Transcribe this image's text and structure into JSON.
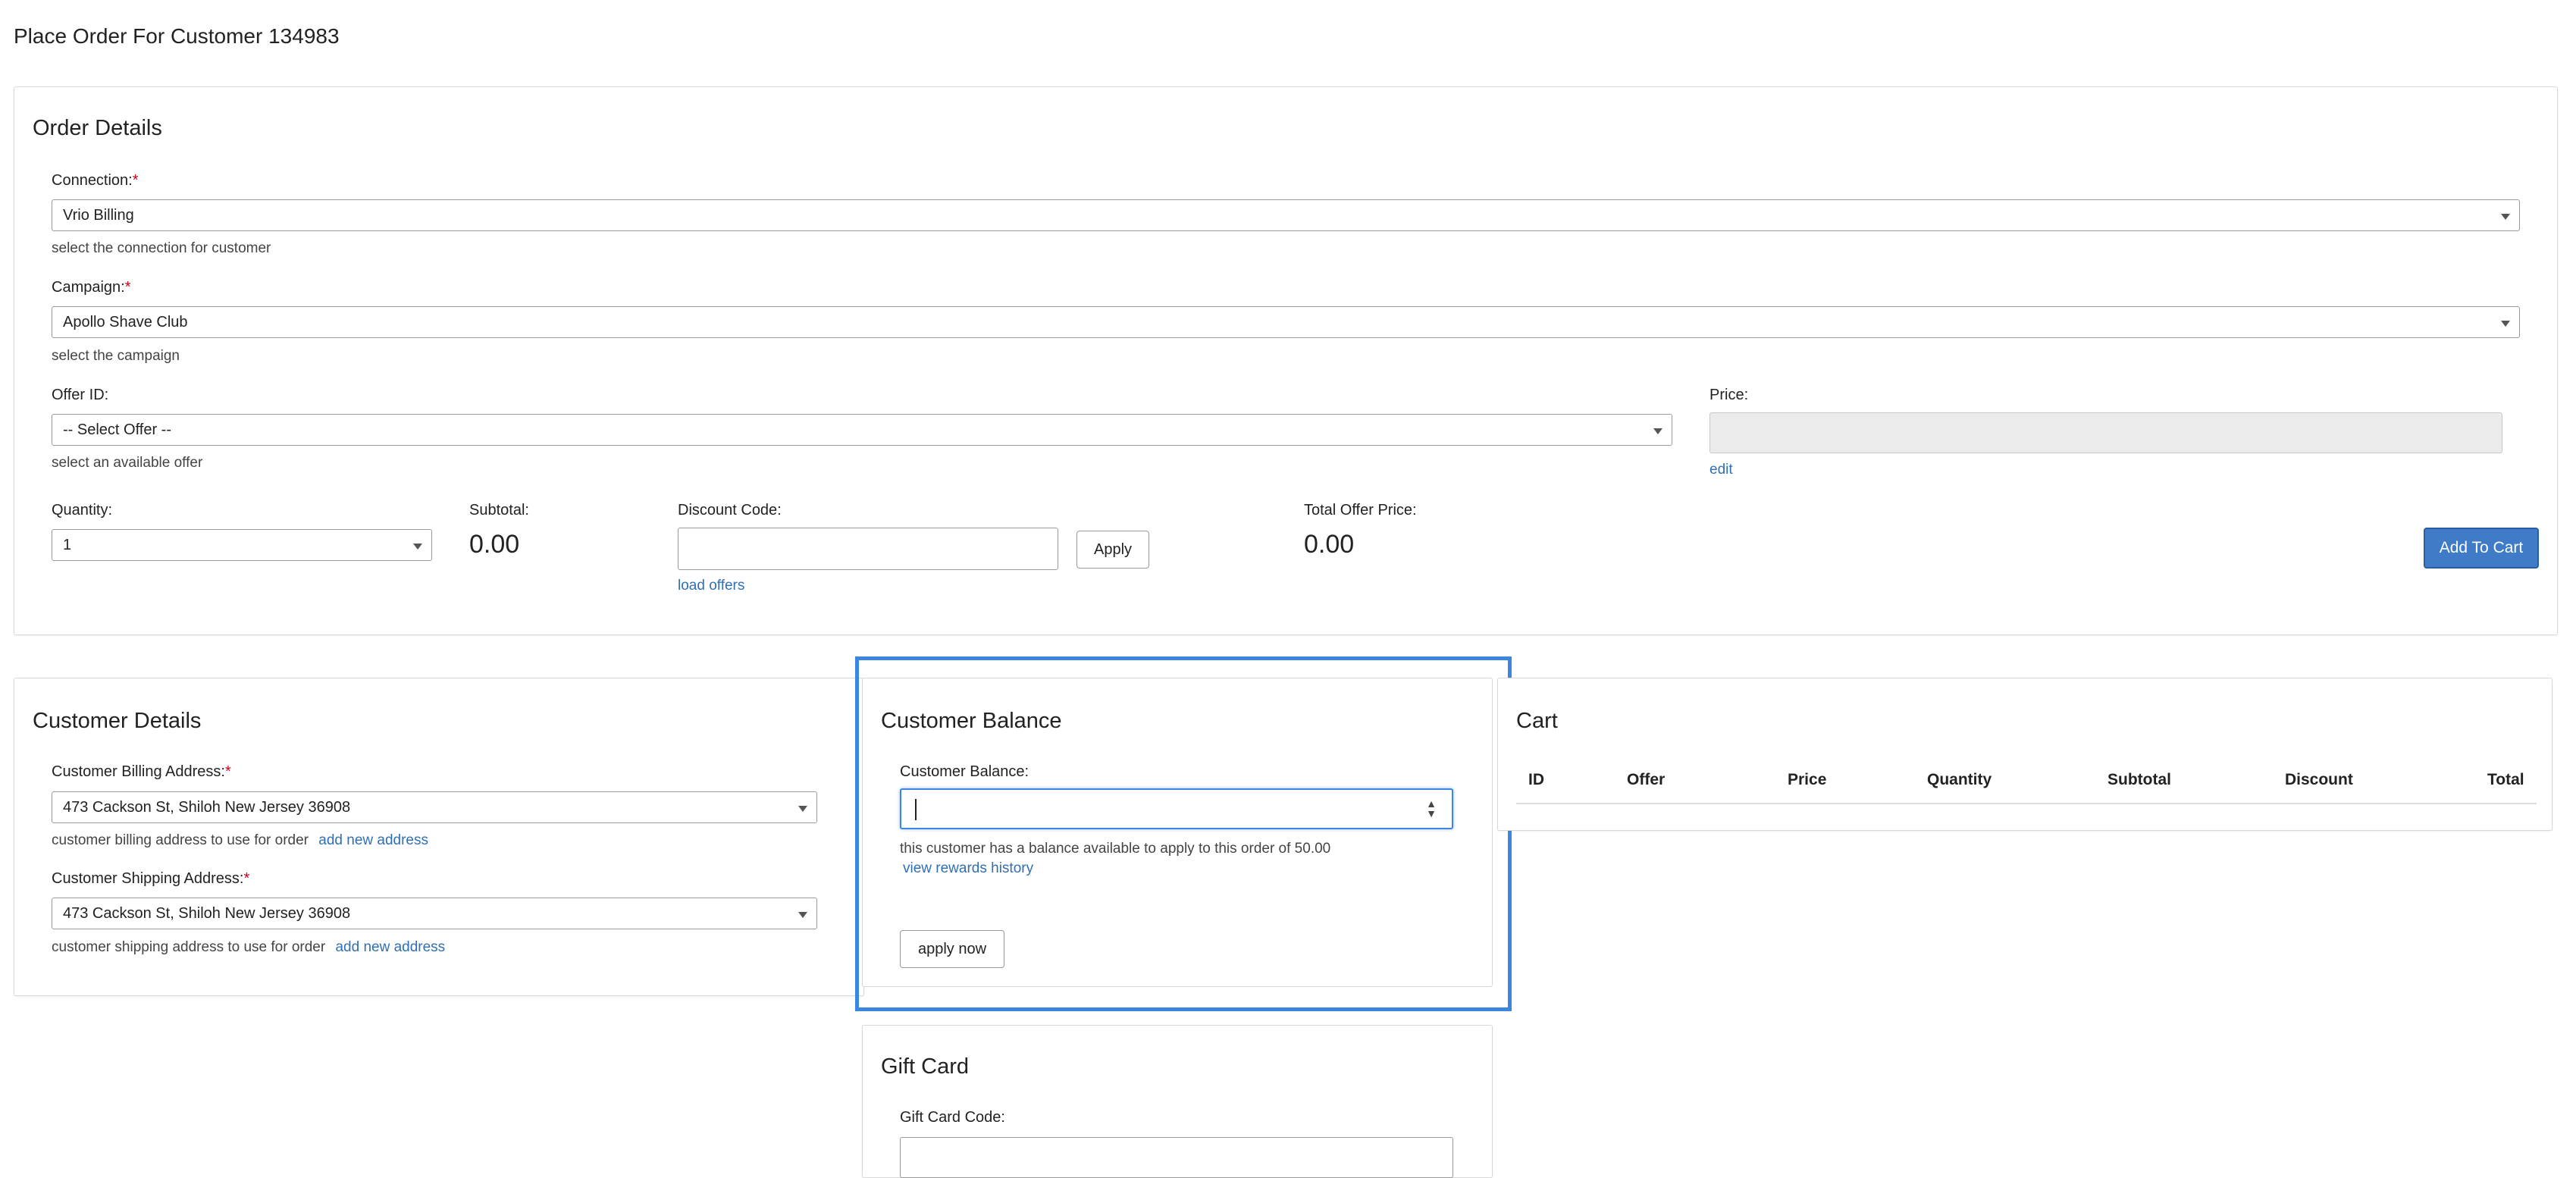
{
  "page": {
    "title": "Place Order For Customer 134983"
  },
  "order_details": {
    "title": "Order Details",
    "connection": {
      "label": "Connection:",
      "required": "*",
      "value": "Vrio Billing",
      "help": "select the connection for customer"
    },
    "campaign": {
      "label": "Campaign:",
      "required": "*",
      "value": "Apollo Shave Club",
      "help": "select the campaign"
    },
    "offer": {
      "label": "Offer ID:",
      "value": "-- Select Offer --",
      "help": "select an available offer"
    },
    "price": {
      "label": "Price:",
      "value": "",
      "edit_link": "edit"
    },
    "quantity": {
      "label": "Quantity:",
      "value": "1"
    },
    "subtotal": {
      "label": "Subtotal:",
      "value": "0.00"
    },
    "discount": {
      "label": "Discount Code:",
      "value": "",
      "apply_label": "Apply",
      "load_offers_link": "load offers"
    },
    "total_offer_price": {
      "label": "Total Offer Price:",
      "value": "0.00"
    },
    "add_to_cart_label": "Add To Cart"
  },
  "customer_details": {
    "title": "Customer Details",
    "billing": {
      "label": "Customer Billing Address:",
      "required": "*",
      "value": "473 Cackson St, Shiloh New Jersey 36908",
      "help": "customer billing address to use for order",
      "add_link": "add new address"
    },
    "shipping": {
      "label": "Customer Shipping Address:",
      "required": "*",
      "value": "473 Cackson St, Shiloh New Jersey 36908",
      "help": "customer shipping address to use for order",
      "add_link": "add new address"
    }
  },
  "customer_balance": {
    "title": "Customer Balance",
    "label": "Customer Balance:",
    "value": "",
    "help": "this customer has a balance available to apply to this order of 50.00",
    "rewards_link": "view rewards history",
    "apply_label": "apply now",
    "highlight_color": "#3a86e0"
  },
  "gift_card": {
    "title": "Gift Card",
    "label": "Gift Card Code:"
  },
  "cart": {
    "title": "Cart",
    "columns": [
      "ID",
      "Offer",
      "Price",
      "Quantity",
      "Subtotal",
      "Discount",
      "Total"
    ],
    "rows": []
  },
  "colors": {
    "link": "#2f6fb5",
    "required": "#d0021b",
    "primary_button": "#3f7bc6"
  }
}
